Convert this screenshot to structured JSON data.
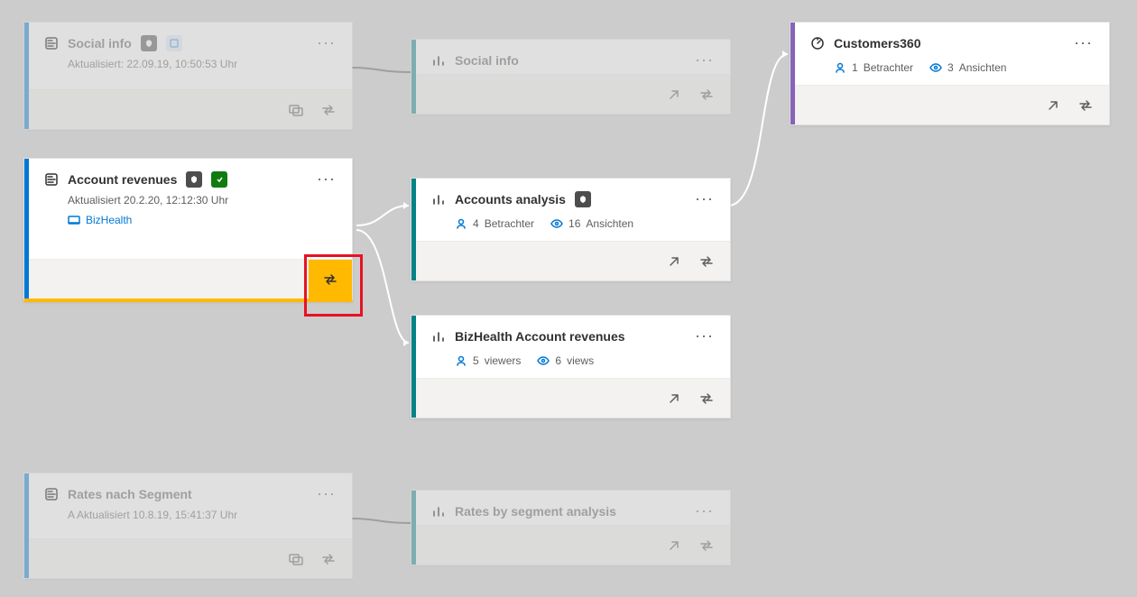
{
  "colors": {
    "accent_blue": "#0078d4",
    "accent_teal": "#038387",
    "accent_purple": "#8764b8",
    "highlight_yellow": "#ffb900",
    "highlight_red": "#e81123"
  },
  "cards": {
    "socialInfoDataset": {
      "title": "Social info",
      "updated": "Aktualisiert: 22.09.19, 10:50:53 Uhr"
    },
    "accountRevenues": {
      "title": "Account revenues",
      "updated": "Aktualisiert 20.2.20, 12:12:30 Uhr",
      "workspace": "BizHealth"
    },
    "ratesSegment": {
      "title": "Rates nach Segment",
      "updated": "A Aktualisiert 10.8.19, 15:41:37 Uhr"
    },
    "socialInfoReport": {
      "title": "Social info"
    },
    "accountsAnalysis": {
      "title": "Accounts analysis",
      "viewers_count": "4",
      "viewers_label": "Betrachter",
      "views_count": "16",
      "views_label": "Ansichten"
    },
    "bizHealthRevenues": {
      "title": "BizHealth Account revenues",
      "viewers_count": "5",
      "viewers_label": "viewers",
      "views_count": "6",
      "views_label": "views"
    },
    "ratesAnalysis": {
      "title": "Rates by segment analysis"
    },
    "customers360": {
      "title": "Customers360",
      "viewers_count": "1",
      "viewers_label": "Betrachter",
      "views_count": "3",
      "views_label": "Ansichten"
    }
  }
}
